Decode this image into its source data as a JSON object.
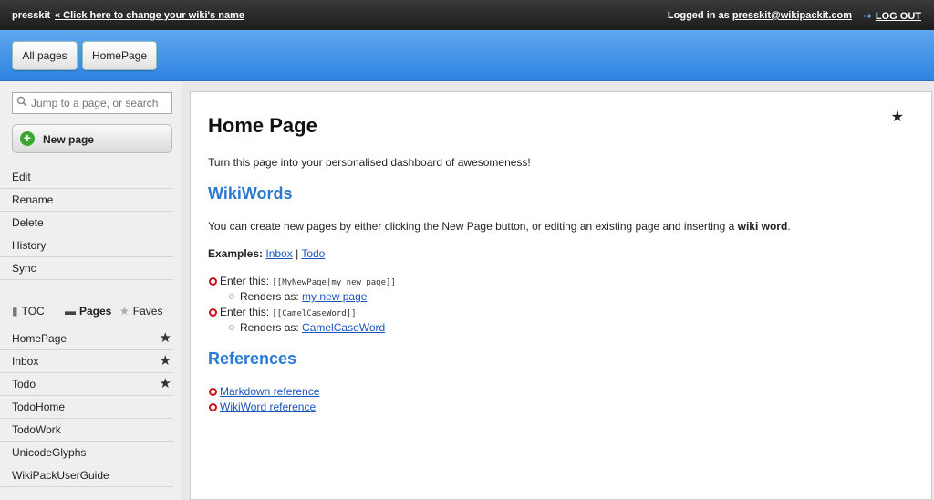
{
  "topbar": {
    "wiki_name": "presskit",
    "rename_link": "« Click here to change your wiki's name",
    "logged_in_prefix": "Logged in as",
    "user_email": "presskit@wikipackit.com",
    "logout_label": "LOG OUT"
  },
  "header": {
    "buttons": [
      {
        "label": "All pages"
      },
      {
        "label": "HomePage"
      }
    ]
  },
  "sidebar": {
    "search_placeholder": "Jump to a page, or search",
    "new_page_label": "New page",
    "actions": [
      {
        "label": "Edit"
      },
      {
        "label": "Rename"
      },
      {
        "label": "Delete"
      },
      {
        "label": "History"
      },
      {
        "label": "Sync"
      }
    ],
    "tabs": [
      {
        "label": "TOC",
        "icon": "book-icon"
      },
      {
        "label": "Pages",
        "icon": "inbox-icon",
        "active": true
      },
      {
        "label": "Faves",
        "icon": "star-icon"
      }
    ],
    "pages": [
      {
        "label": "HomePage",
        "starred": true
      },
      {
        "label": "Inbox",
        "starred": true
      },
      {
        "label": "Todo",
        "starred": true
      },
      {
        "label": "TodoHome",
        "starred": false
      },
      {
        "label": "TodoWork",
        "starred": false
      },
      {
        "label": "UnicodeGlyphs",
        "starred": false
      },
      {
        "label": "WikiPackUserGuide",
        "starred": false
      }
    ]
  },
  "content": {
    "title": "Home Page",
    "intro": "Turn this page into your personalised dashboard of awesomeness!",
    "section1_title": "WikiWords",
    "section1_text_before": "You can create new pages by either clicking the New Page button, or editing an existing page and inserting a",
    "section1_text_bold": "wiki word",
    "section1_text_after": ".",
    "examples_label": "Examples:",
    "example_links": [
      "Inbox",
      "Todo"
    ],
    "example_separator": "|",
    "list": [
      {
        "prefix": "Enter this:",
        "code": "[[MyNewPage|my new page]]",
        "renders_prefix": "Renders as:",
        "renders_link": "my new page"
      },
      {
        "prefix": "Enter this:",
        "code": "[[CamelCaseWord]]",
        "renders_prefix": "Renders as:",
        "renders_link": "CamelCaseWord"
      }
    ],
    "section2_title": "References",
    "references": [
      "Markdown reference",
      "WikiWord reference"
    ]
  },
  "colors": {
    "header_blue": "#3d8fe6",
    "link_blue": "#1a55c0",
    "heading_blue": "#2a7ad2",
    "bullet_red": "#c8121b"
  }
}
